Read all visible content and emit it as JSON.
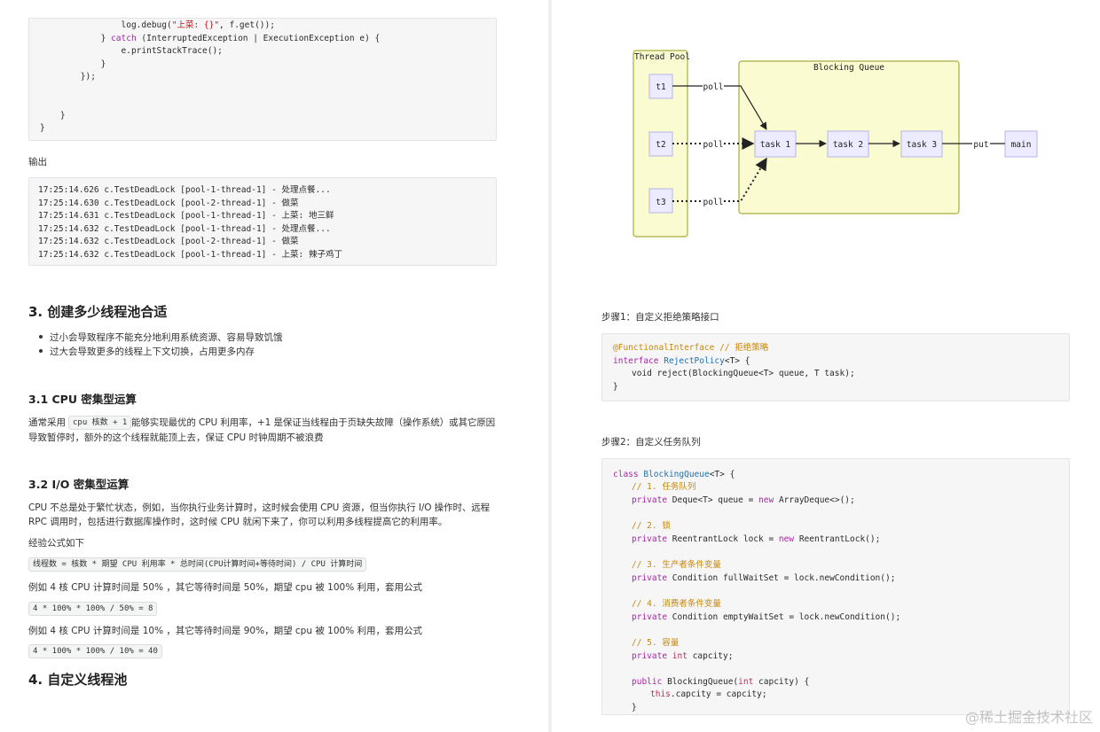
{
  "left": {
    "code_tail": [
      "                log.debug(\"上菜: {}\", f.get());",
      "            } catch (InterruptedException | ExecutionException e) {",
      "                e.printStackTrace();",
      "            }",
      "        });",
      "",
      "",
      "    }",
      "}"
    ],
    "output_label": "输出",
    "output_lines": [
      "17:25:14.626 c.TestDeadLock [pool-1-thread-1] - 处理点餐...",
      "17:25:14.630 c.TestDeadLock [pool-2-thread-1] - 做菜",
      "17:25:14.631 c.TestDeadLock [pool-1-thread-1] - 上菜: 地三鲜",
      "17:25:14.632 c.TestDeadLock [pool-1-thread-1] - 处理点餐...",
      "17:25:14.632 c.TestDeadLock [pool-2-thread-1] - 做菜",
      "17:25:14.632 c.TestDeadLock [pool-1-thread-1] - 上菜: 辣子鸡丁"
    ],
    "h3_title": "3. 创建多少线程池合适",
    "bullets": [
      "过小会导致程序不能充分地利用系统资源、容易导致饥饿",
      "过大会导致更多的线程上下文切换，占用更多内存"
    ],
    "h31_title": "3.1 CPU 密集型运算",
    "p31_pre": "通常采用",
    "p31_code": "cpu 核数 + 1",
    "p31_post": "能够实现最优的 CPU 利用率，+1 是保证当线程由于页缺失故障（操作系统）或其它原因",
    "p31_line2": "导致暂停时，额外的这个线程就能顶上去，保证 CPU 时钟周期不被浪费",
    "h32_title": "3.2 I/O 密集型运算",
    "p32_line1": "CPU 不总是处于繁忙状态，例如，当你执行业务计算时，这时候会使用 CPU 资源，但当你执行 I/O 操作时、远程",
    "p32_line2": "RPC 调用时，包括进行数据库操作时，这时候 CPU 就闲下来了，你可以利用多线程提高它的利用率。",
    "formula_label": "经验公式如下",
    "formula_code": "线程数 = 核数 * 期望 CPU 利用率 * 总时间(CPU计算时间+等待时间) / CPU 计算时间",
    "example1_text": "例如 4 核 CPU 计算时间是 50% ，其它等待时间是 50%，期望 cpu 被 100% 利用，套用公式",
    "example1_code": "4 * 100% * 100% / 50% = 8",
    "example2_text": "例如 4 核 CPU 计算时间是 10% ，其它等待时间是 90%，期望 cpu 被 100% 利用，套用公式",
    "example2_code": "4 * 100% * 100% / 10% = 40",
    "h4_title": "4. 自定义线程池"
  },
  "right": {
    "diagram": {
      "pool_label": "Thread Pool",
      "queue_label": "Blocking Queue",
      "threads": [
        "t1",
        "t2",
        "t3"
      ],
      "poll_label": "poll",
      "tasks": [
        "task 1",
        "task 2",
        "task 3"
      ],
      "put_label": "put",
      "main_label": "main"
    },
    "step1_label": "步骤1：自定义拒绝策略接口",
    "step2_label": "步骤2：自定义任务队列",
    "code1": {
      "annotation": "@FunctionalInterface",
      "comment": "// 拒绝策略",
      "iface_kw": "interface",
      "iface_name": "RejectPolicy",
      "generic": "<T> {",
      "method": "void reject(BlockingQueue<T> queue, T task);",
      "close": "}"
    },
    "code2": {
      "l1_kw": "class",
      "l1_name": "BlockingQueue",
      "l1_rest": "<T> {",
      "c1": "// 1. 任务队列",
      "l2_kw": "private",
      "l2_rest": "Deque<T> queue =",
      "l2_new": "new",
      "l2_end": "ArrayDeque<>();",
      "c2": "// 2. 锁",
      "l3_kw": "private",
      "l3_rest": "ReentrantLock lock =",
      "l3_new": "new",
      "l3_end": "ReentrantLock();",
      "c3": "// 3. 生产者条件变量",
      "l4_kw": "private",
      "l4_rest": "Condition fullWaitSet = lock.newCondition();",
      "c4": "// 4. 消费者条件变量",
      "l5_kw": "private",
      "l5_rest": "Condition emptyWaitSet = lock.newCondition();",
      "c5": "// 5. 容量",
      "l6_kw": "private",
      "l6_type": "int",
      "l6_rest": "capcity;",
      "l7_kw": "public",
      "l7_rest": "BlockingQueue(",
      "l7_type": "int",
      "l7_end": "capcity) {",
      "l8_this": "this",
      "l8_rest": ".capcity = capcity;",
      "l9": "}"
    },
    "watermark": "@稀土掘金技术社区"
  }
}
